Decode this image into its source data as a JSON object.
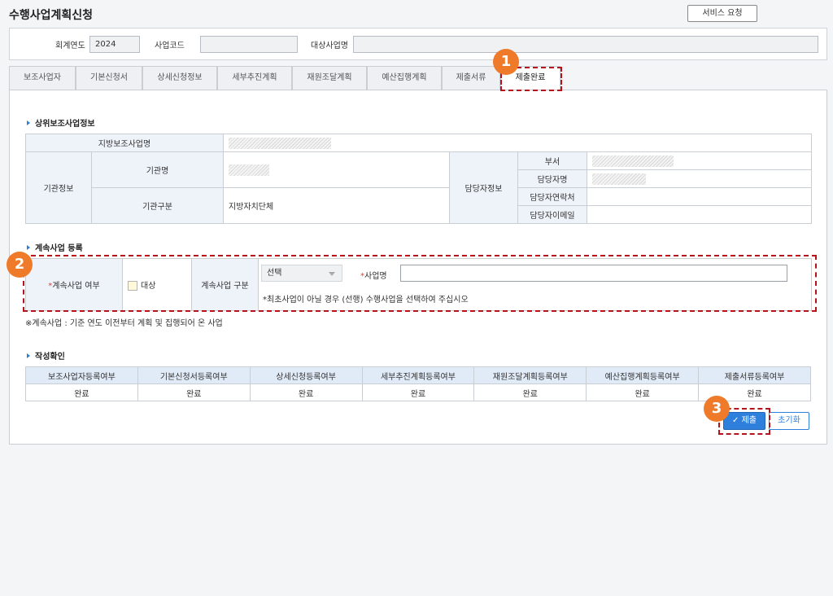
{
  "page": {
    "title": "수행사업계획신청",
    "service_button": "서비스 요청"
  },
  "info_bar": {
    "year_label": "회계연도",
    "year_value": "2024",
    "code_label": "사업코드",
    "project_label": "대상사업명"
  },
  "tabs": [
    "보조사업자",
    "기본신청서",
    "상세신청정보",
    "세부추진계획",
    "재원조달계획",
    "예산집행계획",
    "제출서류",
    "제출완료"
  ],
  "active_tab": "제출완료",
  "section1": {
    "title": "상위보조사업정보",
    "local_project_label": "지방보조사업명",
    "org_info_label": "기관정보",
    "org_name_label": "기관명",
    "org_type_label": "기관구분",
    "org_type_value": "지방자치단체",
    "contact_info_label": "담당자정보",
    "dept_label": "부서",
    "manager_label": "담당자명",
    "phone_label": "담당자연락처",
    "email_label": "담당자이메일"
  },
  "section2": {
    "title": "계속사업 등록",
    "continuing_label": "계속사업 여부",
    "required_mark": "*",
    "checkbox_label": "대상",
    "category_label": "계속사업 구분",
    "select_value": "선택",
    "project_name_label": "사업명",
    "hint": "*최초사업이 아닐 경우 (선행) 수행사업을 선택하여 주십시오",
    "footnote": "※계속사업 : 기준 연도 이전부터 계획 및 집행되어 온 사업"
  },
  "section3": {
    "title": "작성확인",
    "headers": [
      "보조사업자등록여부",
      "기본신청서등록여부",
      "상세신청등록여부",
      "세부추진계획등록여부",
      "재원조달계획등록여부",
      "예산집행계획등록여부",
      "제출서류등록여부"
    ],
    "values": [
      "완료",
      "완료",
      "완료",
      "완료",
      "완료",
      "완료",
      "완료"
    ]
  },
  "buttons": {
    "submit": "✓ 제출",
    "reset": "초기화"
  },
  "badges": [
    "1",
    "2",
    "3"
  ],
  "colors": {
    "accent": "#2f80dc",
    "badge": "#ee7a2a",
    "highlight": "#b5121b"
  }
}
